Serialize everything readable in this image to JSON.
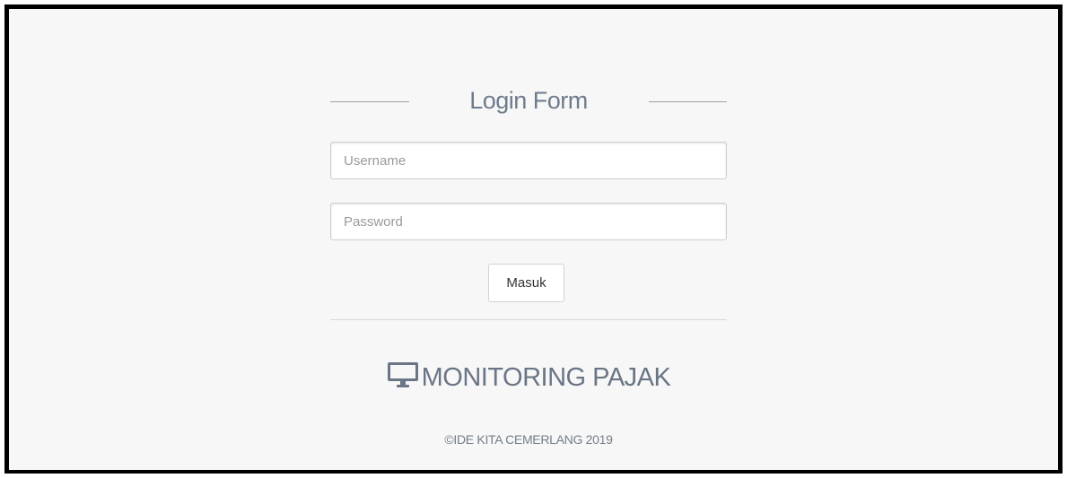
{
  "login_form": {
    "title": "Login Form",
    "username": {
      "value": "",
      "placeholder": "Username"
    },
    "password": {
      "value": "",
      "placeholder": "Password"
    },
    "submit_label": "Masuk"
  },
  "brand": {
    "icon": "monitor-icon",
    "name": "MONITORING PAJAK"
  },
  "footer": {
    "copyright": "©IDE KITA CEMERLANG 2019"
  },
  "colors": {
    "background": "#f7f7f7",
    "frame_border": "#000000",
    "title_text": "#6e7c8c",
    "brand_text": "#6a7686"
  }
}
